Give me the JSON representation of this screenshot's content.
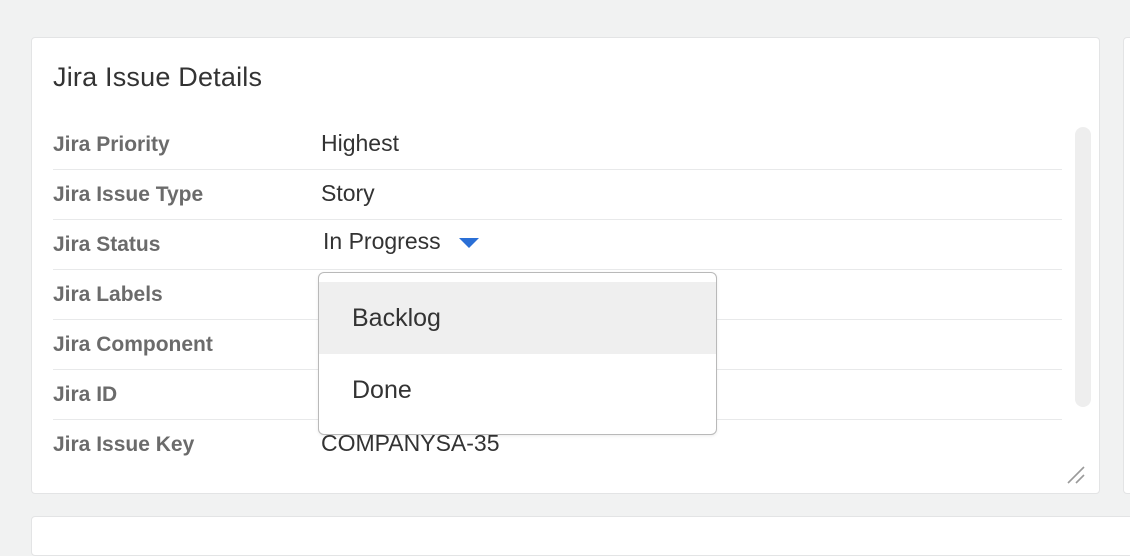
{
  "card": {
    "title": "Jira Issue Details"
  },
  "fields": [
    {
      "label": "Jira Priority",
      "value": "Highest"
    },
    {
      "label": "Jira Issue Type",
      "value": "Story"
    },
    {
      "label": "Jira Status",
      "value": "In Progress"
    },
    {
      "label": "Jira Labels",
      "value": ""
    },
    {
      "label": "Jira Component",
      "value": ""
    },
    {
      "label": "Jira ID",
      "value": ""
    },
    {
      "label": "Jira Issue Key",
      "value": "COMPANYSA-35"
    }
  ],
  "status_dropdown": {
    "selected": "In Progress",
    "options": [
      "Backlog",
      "Done"
    ],
    "highlighted_option": "Backlog"
  },
  "colors": {
    "accent": "#2a6fd6",
    "label_text": "#6b6b6b",
    "value_text": "#333333",
    "page_background": "#f1f2f2",
    "highlight": "#efefef"
  },
  "icons": {
    "status_caret": "caret-down-icon",
    "resize": "resize-handle-icon"
  }
}
